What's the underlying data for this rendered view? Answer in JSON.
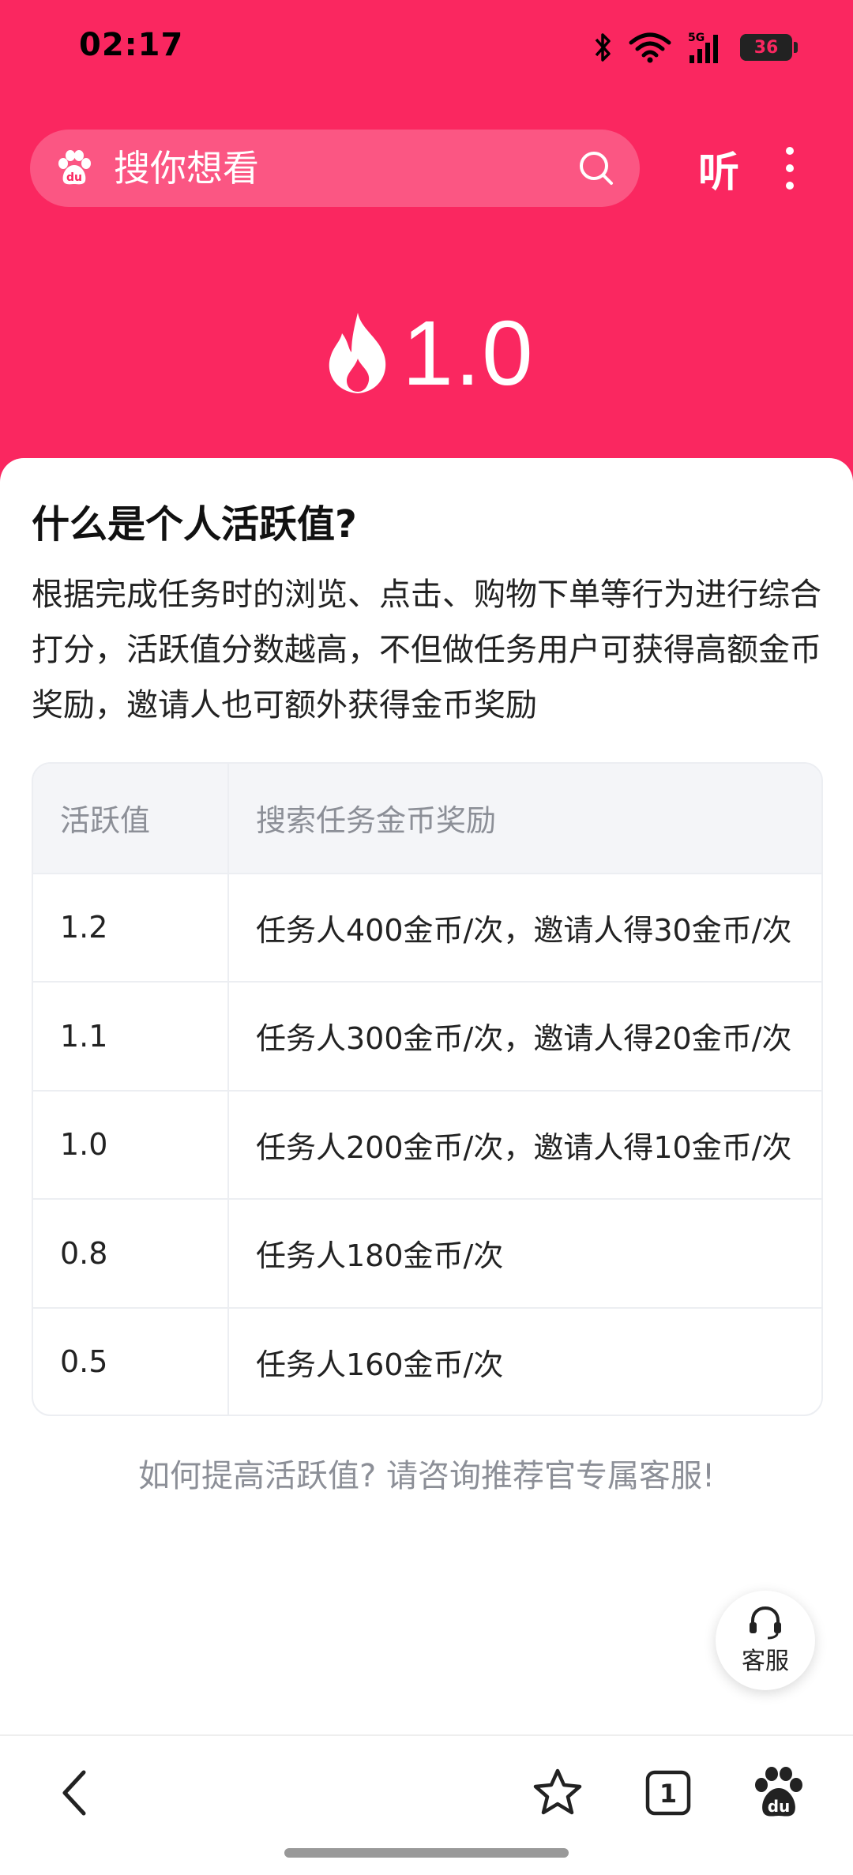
{
  "status_bar": {
    "time": "02:17",
    "network": "5G",
    "battery": "36",
    "battery_level": 0.36
  },
  "search": {
    "placeholder": "搜你想看",
    "listen_label": "听"
  },
  "score": {
    "value": "1.0"
  },
  "card": {
    "title": "什么是个人活跃值?",
    "description": "根据完成任务时的浏览、点击、购物下单等行为进行综合打分，活跃值分数越高，不但做任务用户可获得高额金币奖励，邀请人也可额外获得金币奖励"
  },
  "table": {
    "headers": [
      "活跃值",
      "搜索任务金币奖励"
    ],
    "rows": [
      [
        "1.2",
        "任务人400金币/次，邀请人得30金币/次"
      ],
      [
        "1.1",
        "任务人300金币/次，邀请人得20金币/次"
      ],
      [
        "1.0",
        "任务人200金币/次，邀请人得10金币/次"
      ],
      [
        "0.8",
        "任务人180金币/次"
      ],
      [
        "0.5",
        "任务人160金币/次"
      ]
    ]
  },
  "footer_note": "如何提高活跃值? 请咨询推荐官专属客服!",
  "service_button": {
    "label": "客服",
    "icon": "headset-icon"
  },
  "bottom_nav": {
    "tab_count": "1",
    "icons": [
      "back-arrow-icon",
      "star-icon",
      "tabs-icon",
      "baidu-paw-icon"
    ]
  },
  "colors": {
    "brand": "#FA2760",
    "text_primary": "#222222",
    "text_secondary": "#8C8F97",
    "table_header_bg": "#F4F5F8"
  }
}
